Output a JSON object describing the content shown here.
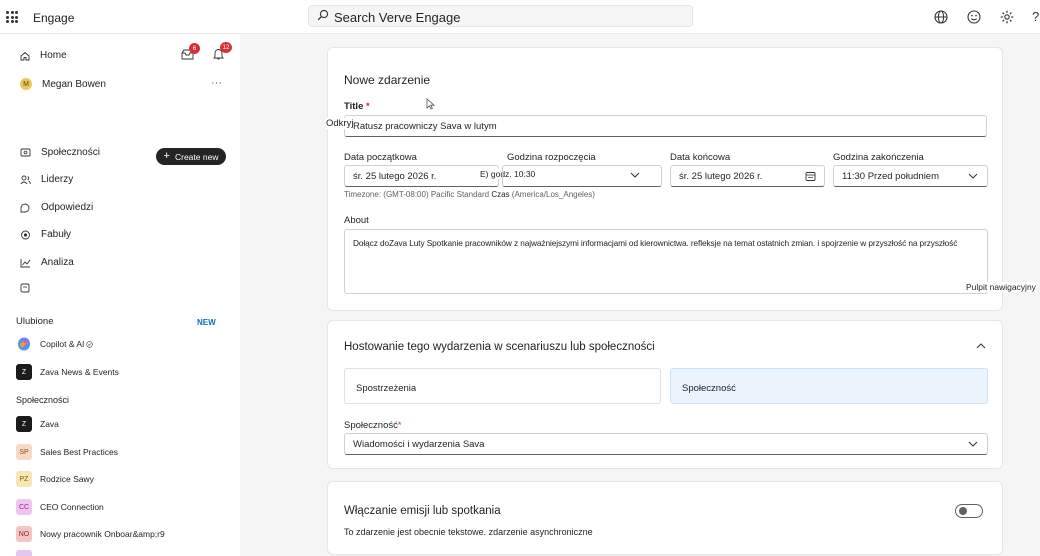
{
  "app": {
    "title": "Engage"
  },
  "search": {
    "placeholder": "Search Verve Engage"
  },
  "sidebar": {
    "home": "Home",
    "user": {
      "name": "Megan Bowen",
      "initial": "M",
      "more": "···"
    },
    "inbox_badge": "6",
    "notifications_badge": "12",
    "create_new": "Create new",
    "nav": [
      "Społeczności",
      "Liderzy",
      "Odpowiedzi",
      "Fabuły",
      "Analiza"
    ],
    "new_tag": "NEW",
    "favorites_heading": "Ulubione",
    "favorites": [
      {
        "label": "Copilot & AI",
        "icon": "copilot-icon"
      },
      {
        "label": "Zava News & Events",
        "initials": "Z"
      }
    ],
    "communities_heading": "Społeczności",
    "communities": [
      {
        "label": "Zava",
        "initials": "Z",
        "bg": "#1b1b1b",
        "fg": "#ffffff"
      },
      {
        "label": "Sales Best Practices",
        "initials": "SP",
        "bg": "#f6d9c6",
        "fg": "#8a4b25"
      },
      {
        "label": "Rodzice Sawy",
        "initials": "PZ",
        "bg": "#f8e6b8",
        "fg": "#7a5c10"
      },
      {
        "label": "CEO Connection",
        "initials": "CC",
        "bg": "#f0c6ef",
        "fg": "#8a2a86"
      },
      {
        "label": "Nowy pracownik Onboar&amp;r9",
        "initials": "NO",
        "bg": "#f3c6c6",
        "fg": "#8a2b2b"
      }
    ]
  },
  "event": {
    "heading": "Nowe zdarzenie",
    "title_label": "Title",
    "required_mark": "*",
    "title_value": "Ratusz pracowniczy Sava w lutym",
    "overlay_open": "Odkryj",
    "start_date_label": "Data początkowa",
    "start_date_value": "śr. 25 lutego 2026 r.",
    "start_time_label": "Godzina rozpoczęcia",
    "start_time_value": "E) godz. 10:30",
    "end_date_label": "Data końcowa",
    "end_date_value": "śr. 25 lutego 2026 r.",
    "end_time_label": "Godzina zakończenia",
    "end_time_value": "11:30 Przed południem",
    "timezone_prefix": "Timezone: (GMT-08:00) Pacific Standard",
    "timezone_czas": "Czas",
    "timezone_suffix": "(America/Los_Angeles)",
    "about_label": "About",
    "about_value": "Dołącz doZava  Luty Spotkanie pracowników z najważniejszymi informacjami od kierownictwa. refleksje na temat ostatnich zmian. i spojrzenie w przyszłość  na przyszłość",
    "overlay_dashboard": "Pulpit nawigacyjny"
  },
  "hosting": {
    "heading": "Hostowanie tego wydarzenia w scenariuszu lub społeczności",
    "option_insights": "Spostrzeżenia",
    "option_community": "Społeczność",
    "community_label": "Społeczność",
    "community_value": "Wiadomości i wydarzenia Sava"
  },
  "broadcast": {
    "heading": "Włączanie emisji lub spotkania",
    "description": "To zdarzenie jest obecnie tekstowe. zdarzenie asynchroniczne",
    "enabled": false
  },
  "colors": {
    "accent": "#0f6cbd",
    "badge": "#d13438",
    "selected_option_bg": "#ebf3fc"
  }
}
